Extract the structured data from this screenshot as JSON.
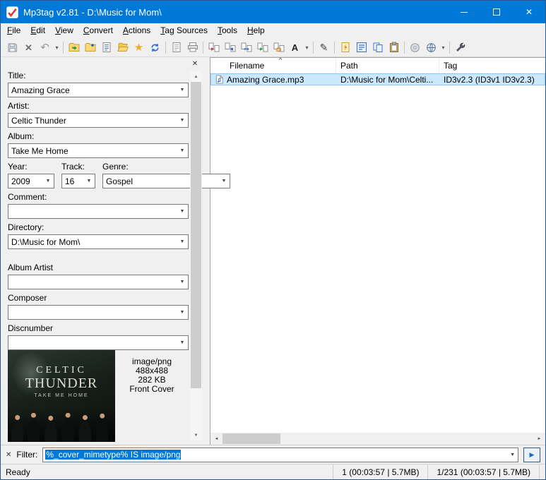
{
  "window": {
    "title": "Mp3tag v2.81  -  D:\\Music for Mom\\"
  },
  "menu": {
    "items": [
      "File",
      "Edit",
      "View",
      "Convert",
      "Actions",
      "Tag Sources",
      "Tools",
      "Help"
    ]
  },
  "toolbar": {
    "icons": [
      "save-tag",
      "remove-tag",
      "undo",
      "undo-menu",
      "change-directory",
      "add-directory",
      "edit-playlist",
      "open-folder",
      "favorite-directories",
      "refresh",
      "playlist-file",
      "print",
      "convert-tag-filename",
      "convert-filename-tag",
      "convert-filename-filename",
      "convert-textfile-tag",
      "convert-tag-tag",
      "case-conversion",
      "case-conversion-menu",
      "actions",
      "quick-actions",
      "extended-tags",
      "copy-tag",
      "paste-tag",
      "freedb",
      "web-sources",
      "web-sources-menu",
      "options"
    ]
  },
  "tag_panel": {
    "title": {
      "label": "Title:",
      "value": "Amazing Grace"
    },
    "artist": {
      "label": "Artist:",
      "value": "Celtic Thunder"
    },
    "album": {
      "label": "Album:",
      "value": "Take Me Home"
    },
    "year": {
      "label": "Year:",
      "value": "2009"
    },
    "track": {
      "label": "Track:",
      "value": "16"
    },
    "genre": {
      "label": "Genre:",
      "value": "Gospel"
    },
    "comment": {
      "label": "Comment:",
      "value": ""
    },
    "directory": {
      "label": "Directory:",
      "value": "D:\\Music for Mom\\"
    },
    "album_artist": {
      "label": "Album Artist",
      "value": ""
    },
    "composer": {
      "label": "Composer",
      "value": ""
    },
    "discnumber": {
      "label": "Discnumber",
      "value": ""
    },
    "cover": {
      "art_text1": "CELTIC",
      "art_text2": "THUNDER",
      "art_text3": "TAKE ME HOME",
      "info": [
        "image/png",
        "488x488",
        "282 KB",
        "Front Cover"
      ]
    }
  },
  "file_list": {
    "columns": [
      "Filename",
      "Path",
      "Tag"
    ],
    "rows": [
      {
        "filename": "Amazing Grace.mp3",
        "path": "D:\\Music for Mom\\Celti...",
        "tag": "ID3v2.3 (ID3v1 ID3v2.3)"
      }
    ]
  },
  "filter": {
    "label": "Filter:",
    "value": "%_cover_mimetype% IS image/png"
  },
  "status_bar": {
    "ready": "Ready",
    "selected": "1 (00:03:57 | 5.7MB)",
    "total": "1/231 (00:03:57 | 5.7MB)"
  },
  "icons": {
    "close": "✕",
    "chevron-down": "▼",
    "dropdown": "▾",
    "undo": "↶",
    "star": "★",
    "pencil": "✎",
    "case": "A",
    "sort-asc": "^",
    "scroll-up": "▲",
    "scroll-down": "▼",
    "scroll-left": "◄",
    "scroll-right": "►",
    "play": "▶"
  },
  "colors": {
    "titlebar": "#0078d7",
    "row_selection": "#cce8ff",
    "text_selection": "#0078d7"
  }
}
